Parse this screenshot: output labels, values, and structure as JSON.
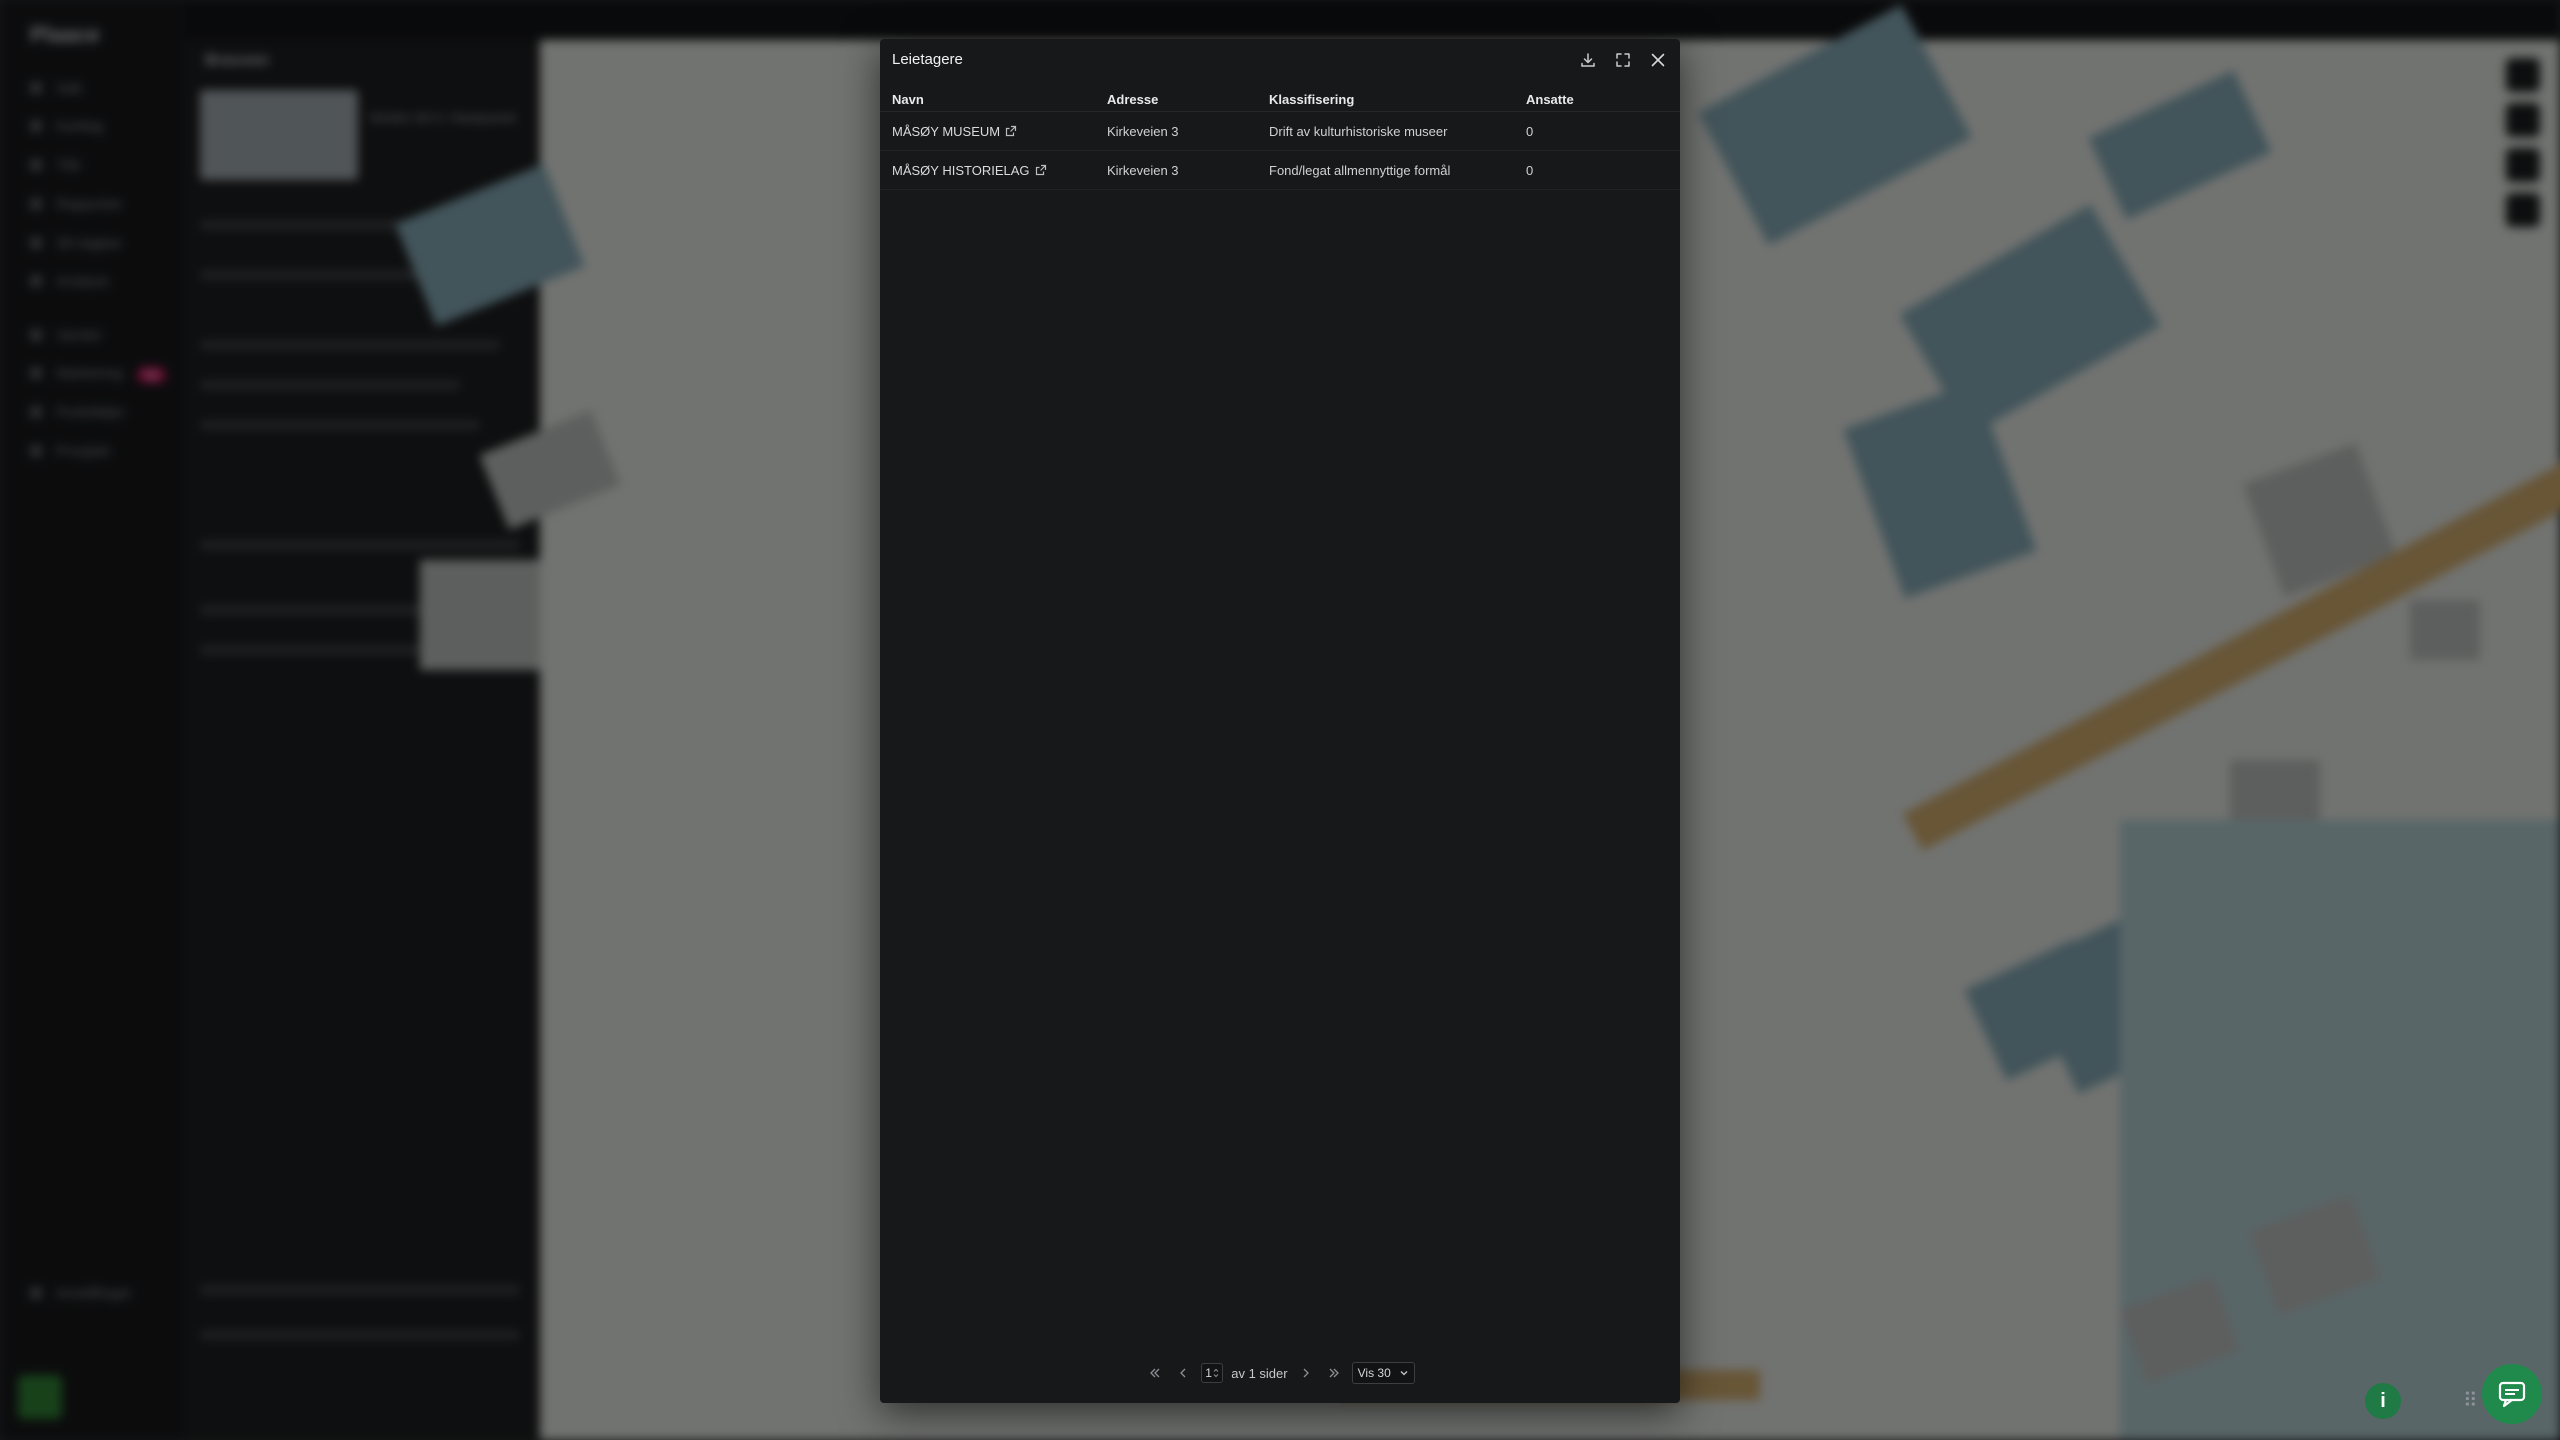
{
  "modal": {
    "title": "Leietagere",
    "columns": [
      "Navn",
      "Adresse",
      "Klassifisering",
      "Ansatte"
    ],
    "rows": [
      {
        "navn": "MÅSØY MUSEUM",
        "adresse": "Kirkeveien 3",
        "klassifisering": "Drift av kulturhistoriske museer",
        "ansatte": "0"
      },
      {
        "navn": "MÅSØY HISTORIELAG",
        "adresse": "Kirkeveien 3",
        "klassifisering": "Fond/legat allmennyttige formål",
        "ansatte": "0"
      }
    ],
    "pagination": {
      "current_page": "1",
      "of_pages_label": "av 1 sider",
      "page_size_label": "Vis 30"
    }
  },
  "background": {
    "brand": "Plaace",
    "nav_items": [
      "Søk",
      "Kartlag",
      "Tiår",
      "Rapporter",
      "3D-lagbar",
      "Analyse",
      "Varsler",
      "Markering",
      "Porteføljer",
      "Prosjekt",
      "Innstillinger"
    ],
    "new_badge": "Ny",
    "panel_heading": "Bravoen",
    "panel_address": "Nordre Vei 5, Havøysund"
  },
  "icons": {
    "download": "download-icon",
    "expand": "expand-icon",
    "close": "close-icon",
    "external": "external-link-icon",
    "first": "first-page-icon",
    "prev": "prev-page-icon",
    "next": "next-page-icon",
    "last": "last-page-icon",
    "info": "info-icon",
    "chat": "chat-icon"
  },
  "colors": {
    "modal_bg": "#17181a",
    "accent_green": "#1f8a4c",
    "map_buildings": "#7fa3ae",
    "map_road": "#c8a56a"
  }
}
